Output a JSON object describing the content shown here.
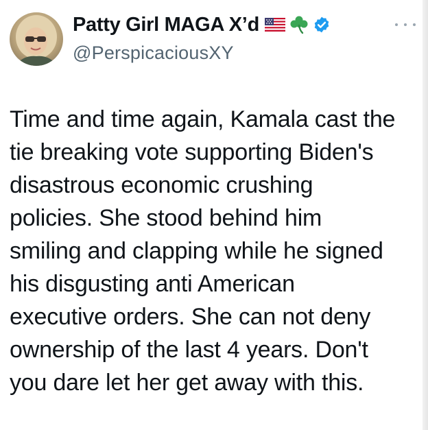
{
  "tweet": {
    "author": {
      "display_name": "Patty Girl MAGA X’d",
      "handle": "@PerspicaciousXY",
      "badges": [
        "us-flag-icon",
        "shamrock-icon",
        "verified-badge-icon"
      ],
      "avatar": "profile-photo"
    },
    "more_menu_icon": "more-options-icon",
    "text_lines": [
      "Time and time again, Kamala cast the",
      "tie breaking vote supporting Biden's",
      "disastrous economic crushing",
      "policies. She stood behind him",
      "smiling and clapping while he signed",
      "his disgusting anti American",
      "executive orders. She can not deny",
      "ownership of the last 4 years. Don't",
      "you dare let her get away with this."
    ]
  },
  "colors": {
    "text": "#0f1419",
    "secondary_text": "#536471",
    "verified": "#1d9bf0",
    "shamrock": "#3aa655"
  }
}
